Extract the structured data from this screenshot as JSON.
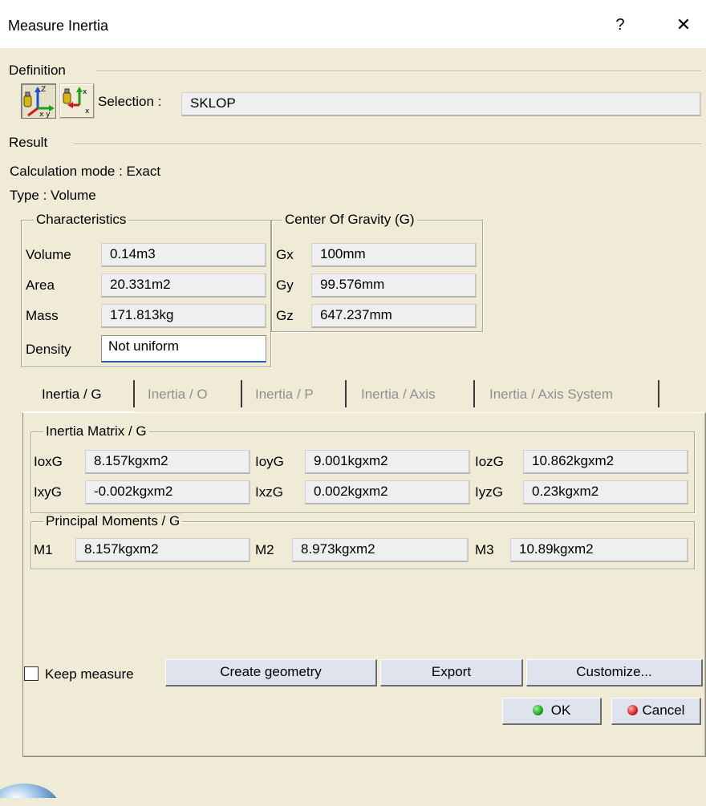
{
  "window": {
    "title": "Measure Inertia",
    "help_label": "?",
    "close_label": "✕"
  },
  "definition": {
    "group_label": "Definition",
    "tool_a_icon": "measure-inertia-3d-icon",
    "tool_b_icon": "measure-inertia-2d-icon",
    "selection_label": "Selection :",
    "selection_value": "SKLOP"
  },
  "result": {
    "group_label": "Result",
    "calc_mode_label": "Calculation mode :",
    "calc_mode_value": "Exact",
    "type_label": "Type :",
    "type_value": "Volume"
  },
  "characteristics": {
    "group_label": "Characteristics",
    "rows": [
      {
        "label": "Volume",
        "value": "0.14m3"
      },
      {
        "label": "Area",
        "value": "20.331m2"
      },
      {
        "label": "Mass",
        "value": "171.813kg"
      },
      {
        "label": "Density",
        "value": "Not uniform"
      }
    ]
  },
  "cog": {
    "group_label": "Center Of Gravity (G)",
    "rows": [
      {
        "label": "Gx",
        "value": "100mm"
      },
      {
        "label": "Gy",
        "value": "99.576mm"
      },
      {
        "label": "Gz",
        "value": "647.237mm"
      }
    ]
  },
  "tabs": [
    {
      "label": "Inertia / G",
      "active": true
    },
    {
      "label": "Inertia / O",
      "active": false
    },
    {
      "label": "Inertia / P",
      "active": false
    },
    {
      "label": "Inertia / Axis",
      "active": false
    },
    {
      "label": "Inertia / Axis System",
      "active": false
    }
  ],
  "inertia_matrix": {
    "group_label": "Inertia Matrix / G",
    "row1": [
      {
        "label": "IoxG",
        "value": "8.157kgxm2"
      },
      {
        "label": "IoyG",
        "value": "9.001kgxm2"
      },
      {
        "label": "IozG",
        "value": "10.862kgxm2"
      }
    ],
    "row2": [
      {
        "label": "IxyG",
        "value": "-0.002kgxm2"
      },
      {
        "label": "IxzG",
        "value": "0.002kgxm2"
      },
      {
        "label": "IyzG",
        "value": "0.23kgxm2"
      }
    ]
  },
  "principal_moments": {
    "group_label": "Principal Moments / G",
    "items": [
      {
        "label": "M1",
        "value": "8.157kgxm2"
      },
      {
        "label": "M2",
        "value": "8.973kgxm2"
      },
      {
        "label": "M3",
        "value": "10.89kgxm2"
      }
    ]
  },
  "footer": {
    "keep_measure_label": "Keep measure",
    "keep_measure_checked": false,
    "create_geometry_label": "Create geometry",
    "export_label": "Export",
    "customize_label": "Customize...",
    "ok_label": "OK",
    "cancel_label": "Cancel",
    "ok_color": "#1fa31f",
    "cancel_color": "#d42020"
  }
}
